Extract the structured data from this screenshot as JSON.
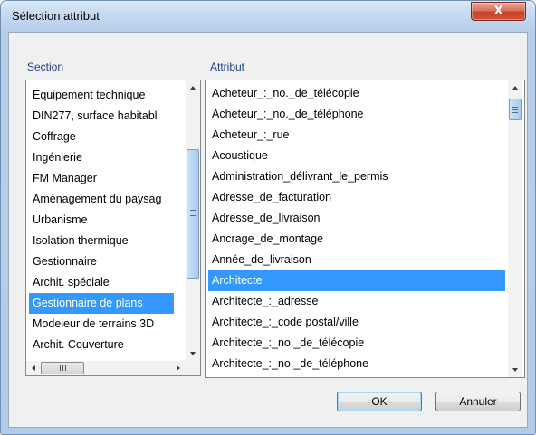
{
  "dialog": {
    "title": "Sélection attribut",
    "close_glyph": "X"
  },
  "section": {
    "header": "Section",
    "items": [
      "Equipement technique",
      "DIN277, surface habitabl",
      "Coffrage",
      "Ingénierie",
      "FM Manager",
      "Aménagement du paysag",
      "Urbanisme",
      "Isolation thermique",
      "Gestionnaire",
      "Archit. spéciale",
      "Gestionnaire de plans",
      "Modeleur de terrains 3D",
      "Archit. Couverture"
    ],
    "selected_index": 10
  },
  "attribut": {
    "header": "Attribut",
    "items": [
      "Acheteur_:_no._de_télécopie",
      "Acheteur_:_no._de_téléphone",
      "Acheteur_:_rue",
      "Acoustique",
      "Administration_délivrant_le_permis",
      "Adresse_de_facturation",
      "Adresse_de_livraison",
      "Ancrage_de_montage",
      "Année_de_livraison",
      "Architecte",
      "Architecte_:_adresse",
      "Architecte_:_code postal/ville",
      "Architecte_:_no._de_télécopie",
      "Architecte_:_no._de_téléphone"
    ],
    "selected_index": 9
  },
  "buttons": {
    "ok": "OK",
    "cancel": "Annuler"
  },
  "colors": {
    "selection": "#3399ff",
    "header_text": "#1f3e8e",
    "close_button": "#c2432b"
  }
}
